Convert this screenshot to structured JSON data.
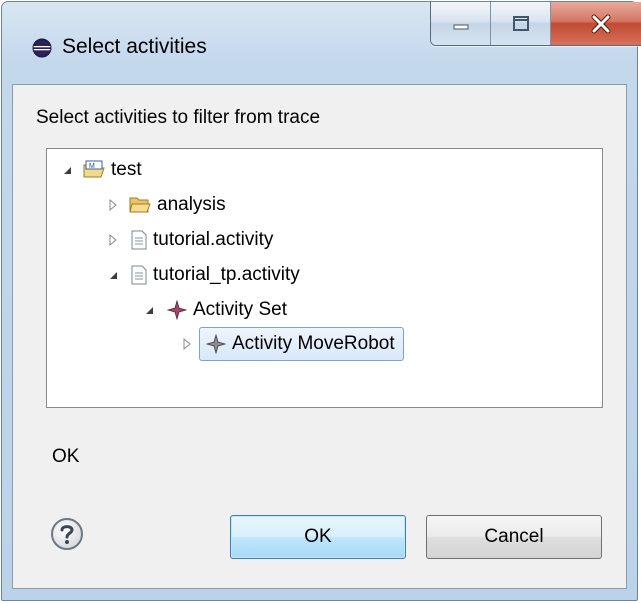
{
  "window": {
    "title": "Select activities",
    "controls": {
      "minimize": "minimize-icon",
      "maximize": "maximize-icon",
      "close": "close-icon"
    }
  },
  "dialog": {
    "prompt": "Select activities to filter from trace",
    "status": "OK"
  },
  "tree": {
    "items": [
      {
        "label": "test",
        "icon": "project-icon",
        "expanded": true
      },
      {
        "label": "analysis",
        "icon": "folder-icon",
        "expanded": false
      },
      {
        "label": "tutorial.activity",
        "icon": "file-icon",
        "expanded": false
      },
      {
        "label": "tutorial_tp.activity",
        "icon": "file-icon",
        "expanded": true
      },
      {
        "label": "Activity Set",
        "icon": "activity-set-icon",
        "expanded": true
      },
      {
        "label": "Activity MoveRobot",
        "icon": "activity-icon",
        "expanded": false,
        "selected": true
      }
    ]
  },
  "buttons": {
    "ok": "OK",
    "cancel": "Cancel",
    "help": "help-icon"
  },
  "colors": {
    "title_bar": "#c4d8ec",
    "close_button": "#c24a32",
    "selection": "#d9e8fa",
    "default_button": "#bee6fd"
  }
}
